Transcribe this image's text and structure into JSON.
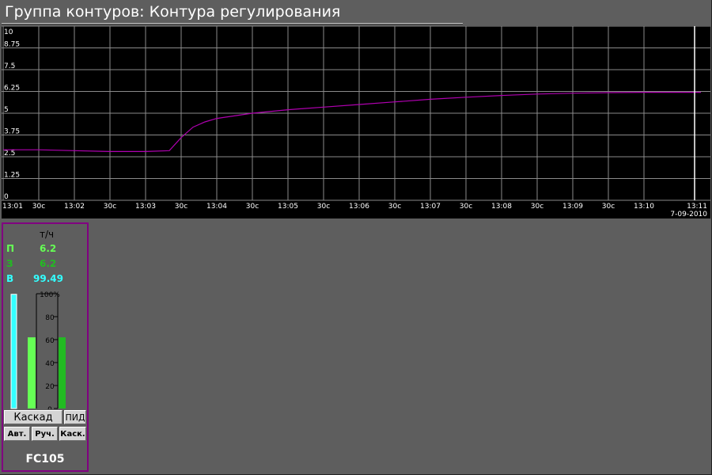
{
  "title": "Группа контуров: Контура регулирования",
  "chart_data": {
    "type": "line",
    "ylim": [
      0,
      10
    ],
    "y_ticks": [
      "10",
      "8.75",
      "7.5",
      "6.25",
      "5",
      "3.75",
      "2.5",
      "1.25",
      "0"
    ],
    "y_tick_values": [
      10,
      8.75,
      7.5,
      6.25,
      5,
      3.75,
      2.5,
      1.25,
      0
    ],
    "x_ticks": [
      "13:01",
      "30c",
      "13:02",
      "30c",
      "13:03",
      "30c",
      "13:04",
      "30c",
      "13:05",
      "30c",
      "13:06",
      "30c",
      "13:07",
      "30c",
      "13:08",
      "30c",
      "13:09",
      "30c",
      "13:10",
      "13:11"
    ],
    "x_tick_minutes": [
      0,
      0.5,
      1,
      1.5,
      2,
      2.5,
      3,
      3.5,
      4,
      4.5,
      5,
      5.5,
      6,
      6.5,
      7,
      7.5,
      8,
      8.5,
      9,
      9.8
    ],
    "date_label": "7-09-2010",
    "x_start": "13:01",
    "x_end": "13:11",
    "grid": true,
    "series": [
      {
        "color": "#b000b0",
        "x": [
          "13:01:00",
          "13:01:30",
          "13:02:00",
          "13:02:30",
          "13:03:00",
          "13:03:20",
          "13:03:30",
          "13:03:40",
          "13:03:50",
          "13:04:00",
          "13:04:30",
          "13:05:00",
          "13:05:30",
          "13:06:00",
          "13:06:30",
          "13:07:00",
          "13:07:30",
          "13:08:00",
          "13:08:30",
          "13:09:00",
          "13:09:30",
          "13:10:00",
          "13:10:48"
        ],
        "values": [
          2.9,
          2.9,
          2.85,
          2.8,
          2.8,
          2.85,
          3.6,
          4.2,
          4.5,
          4.7,
          5.0,
          5.2,
          5.35,
          5.5,
          5.65,
          5.8,
          5.92,
          6.02,
          6.1,
          6.15,
          6.18,
          6.2,
          6.2
        ]
      }
    ]
  },
  "faceplate": {
    "unit": "т/ч",
    "rows": [
      {
        "letter": "П",
        "value": "6.2",
        "color": "#66ff55"
      },
      {
        "letter": "З",
        "value": "6.2",
        "color": "#22bb22"
      },
      {
        "letter": "В",
        "value": "99.49",
        "color": "#33ffff"
      }
    ],
    "scale_ticks": [
      "100%",
      "80",
      "60",
      "40",
      "20",
      "0"
    ],
    "bars": {
      "output_percent": 99.49,
      "pv_percent": 62,
      "sp_percent": 62,
      "output_color": "#33ffff",
      "pv_color": "#66ff55",
      "sp_color": "#22bb22"
    },
    "mode_label": "Каскад",
    "pid_label": "ПИД",
    "buttons": [
      "Авт.",
      "Руч.",
      "Каск."
    ],
    "tag": "FC105"
  }
}
